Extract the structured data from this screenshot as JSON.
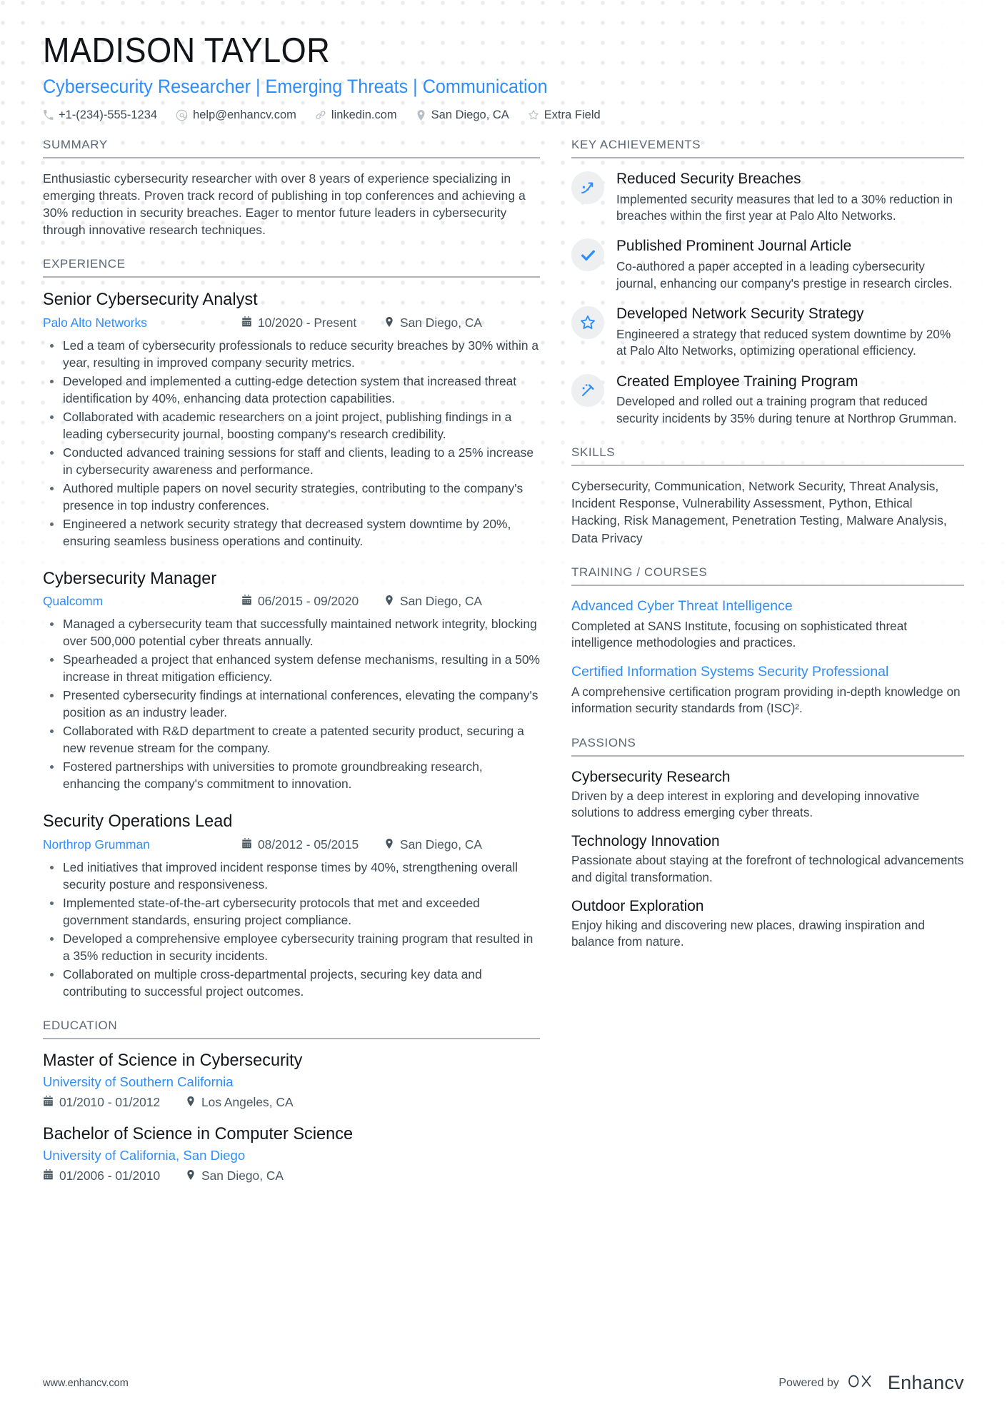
{
  "header": {
    "name": "MADISON TAYLOR",
    "headline": "Cybersecurity Researcher | Emerging Threats | Communication",
    "contacts": [
      {
        "icon": "phone-icon",
        "text": "+1-(234)-555-1234"
      },
      {
        "icon": "email-icon",
        "text": "help@enhancv.com"
      },
      {
        "icon": "link-icon",
        "text": "linkedin.com"
      },
      {
        "icon": "location-icon",
        "text": "San Diego, CA"
      },
      {
        "icon": "star-icon",
        "text": "Extra Field"
      }
    ]
  },
  "left": {
    "summary": {
      "title": "SUMMARY",
      "text": "Enthusiastic cybersecurity researcher with over 8 years of experience specializing in emerging threats. Proven track record of publishing in top conferences and achieving a 30% reduction in security breaches. Eager to mentor future leaders in cybersecurity through innovative research techniques."
    },
    "experience": {
      "title": "EXPERIENCE",
      "jobs": [
        {
          "title": "Senior Cybersecurity Analyst",
          "company": "Palo Alto Networks",
          "dates": "10/2020 - Present",
          "location": "San Diego, CA",
          "bullets": [
            "Led a team of cybersecurity professionals to reduce security breaches by 30% within a year, resulting in improved company security metrics.",
            "Developed and implemented a cutting-edge detection system that increased threat identification by 40%, enhancing data protection capabilities.",
            "Collaborated with academic researchers on a joint project, publishing findings in a leading cybersecurity journal, boosting company's research credibility.",
            "Conducted advanced training sessions for staff and clients, leading to a 25% increase in cybersecurity awareness and performance.",
            "Authored multiple papers on novel security strategies, contributing to the company's presence in top industry conferences.",
            "Engineered a network security strategy that decreased system downtime by 20%, ensuring seamless business operations and continuity."
          ]
        },
        {
          "title": "Cybersecurity Manager",
          "company": "Qualcomm",
          "dates": "06/2015 - 09/2020",
          "location": "San Diego, CA",
          "bullets": [
            "Managed a cybersecurity team that successfully maintained network integrity, blocking over 500,000 potential cyber threats annually.",
            "Spearheaded a project that enhanced system defense mechanisms, resulting in a 50% increase in threat mitigation efficiency.",
            "Presented cybersecurity findings at international conferences, elevating the company's position as an industry leader.",
            "Collaborated with R&D department to create a patented security product, securing a new revenue stream for the company.",
            "Fostered partnerships with universities to promote groundbreaking research, enhancing the company's commitment to innovation."
          ]
        },
        {
          "title": "Security Operations Lead",
          "company": "Northrop Grumman",
          "dates": "08/2012 - 05/2015",
          "location": "San Diego, CA",
          "bullets": [
            "Led initiatives that improved incident response times by 40%, strengthening overall security posture and responsiveness.",
            "Implemented state-of-the-art cybersecurity protocols that met and exceeded government standards, ensuring project compliance.",
            "Developed a comprehensive employee cybersecurity training program that resulted in a 35% reduction in security incidents.",
            "Collaborated on multiple cross-departmental projects, securing key data and contributing to successful project outcomes."
          ]
        }
      ]
    },
    "education": {
      "title": "EDUCATION",
      "entries": [
        {
          "degree": "Master of Science in Cybersecurity",
          "school": "University of Southern California",
          "dates": "01/2010 - 01/2012",
          "location": "Los Angeles, CA"
        },
        {
          "degree": "Bachelor of Science in Computer Science",
          "school": "University of California, San Diego",
          "dates": "01/2006 - 01/2010",
          "location": "San Diego, CA"
        }
      ]
    }
  },
  "right": {
    "achievements": {
      "title": "KEY ACHIEVEMENTS",
      "items": [
        {
          "icon": "rocket-trajectory-icon",
          "title": "Reduced Security Breaches",
          "desc": "Implemented security measures that led to a 30% reduction in breaches within the first year at Palo Alto Networks."
        },
        {
          "icon": "checkmark-icon",
          "title": "Published Prominent Journal Article",
          "desc": "Co-authored a paper accepted in a leading cybersecurity journal, enhancing our company's prestige in research circles."
        },
        {
          "icon": "star-outline-icon",
          "title": "Developed Network Security Strategy",
          "desc": "Engineered a strategy that reduced system downtime by 20% at Palo Alto Networks, optimizing operational efficiency."
        },
        {
          "icon": "magic-wand-icon",
          "title": "Created Employee Training Program",
          "desc": "Developed and rolled out a training program that reduced security incidents by 35% during tenure at Northrop Grumman."
        }
      ]
    },
    "skills": {
      "title": "SKILLS",
      "text": "Cybersecurity, Communication, Network Security, Threat Analysis, Incident Response, Vulnerability Assessment, Python, Ethical Hacking, Risk Management, Penetration Testing, Malware Analysis, Data Privacy"
    },
    "training": {
      "title": "TRAINING / COURSES",
      "courses": [
        {
          "name": "Advanced Cyber Threat Intelligence",
          "desc": "Completed at SANS Institute, focusing on sophisticated threat intelligence methodologies and practices."
        },
        {
          "name": "Certified Information Systems Security Professional",
          "desc": "A comprehensive certification program providing in-depth knowledge on information security standards from (ISC)²."
        }
      ]
    },
    "passions": {
      "title": "PASSIONS",
      "items": [
        {
          "name": "Cybersecurity Research",
          "desc": "Driven by a deep interest in exploring and developing innovative solutions to address emerging cyber threats."
        },
        {
          "name": "Technology Innovation",
          "desc": "Passionate about staying at the forefront of technological advancements and digital transformation."
        },
        {
          "name": "Outdoor Exploration",
          "desc": "Enjoy hiking and discovering new places, drawing inspiration and balance from nature."
        }
      ]
    }
  },
  "footer": {
    "url": "www.enhancv.com",
    "powered_label": "Powered by",
    "brand_name": "Enhancv"
  },
  "colors": {
    "accent": "#2f8dfa",
    "heading": "#5c6873",
    "text": "#39454f",
    "badge_bg": "#eeeff1"
  }
}
